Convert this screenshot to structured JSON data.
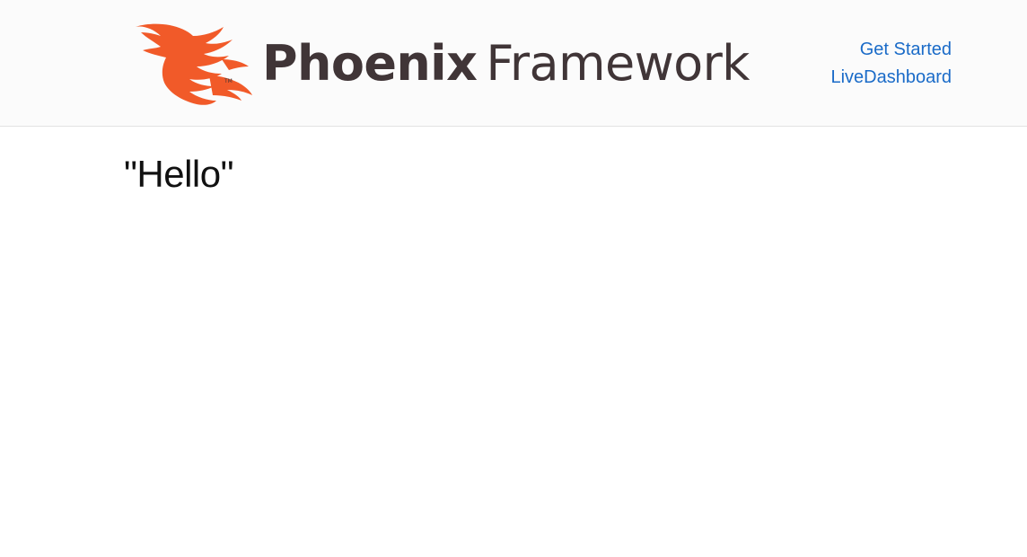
{
  "header": {
    "logo": {
      "mark_icon": "phoenix-bird-icon",
      "brand_name": "Phoenix",
      "brand_suffix": "Framework",
      "mark_color": "#f15a29",
      "text_color": "#403537"
    },
    "nav": {
      "items": [
        {
          "label": "Get Started"
        },
        {
          "label": "LiveDashboard"
        }
      ],
      "link_color": "#1a6bc8"
    }
  },
  "main": {
    "greeting": "\"Hello\""
  }
}
